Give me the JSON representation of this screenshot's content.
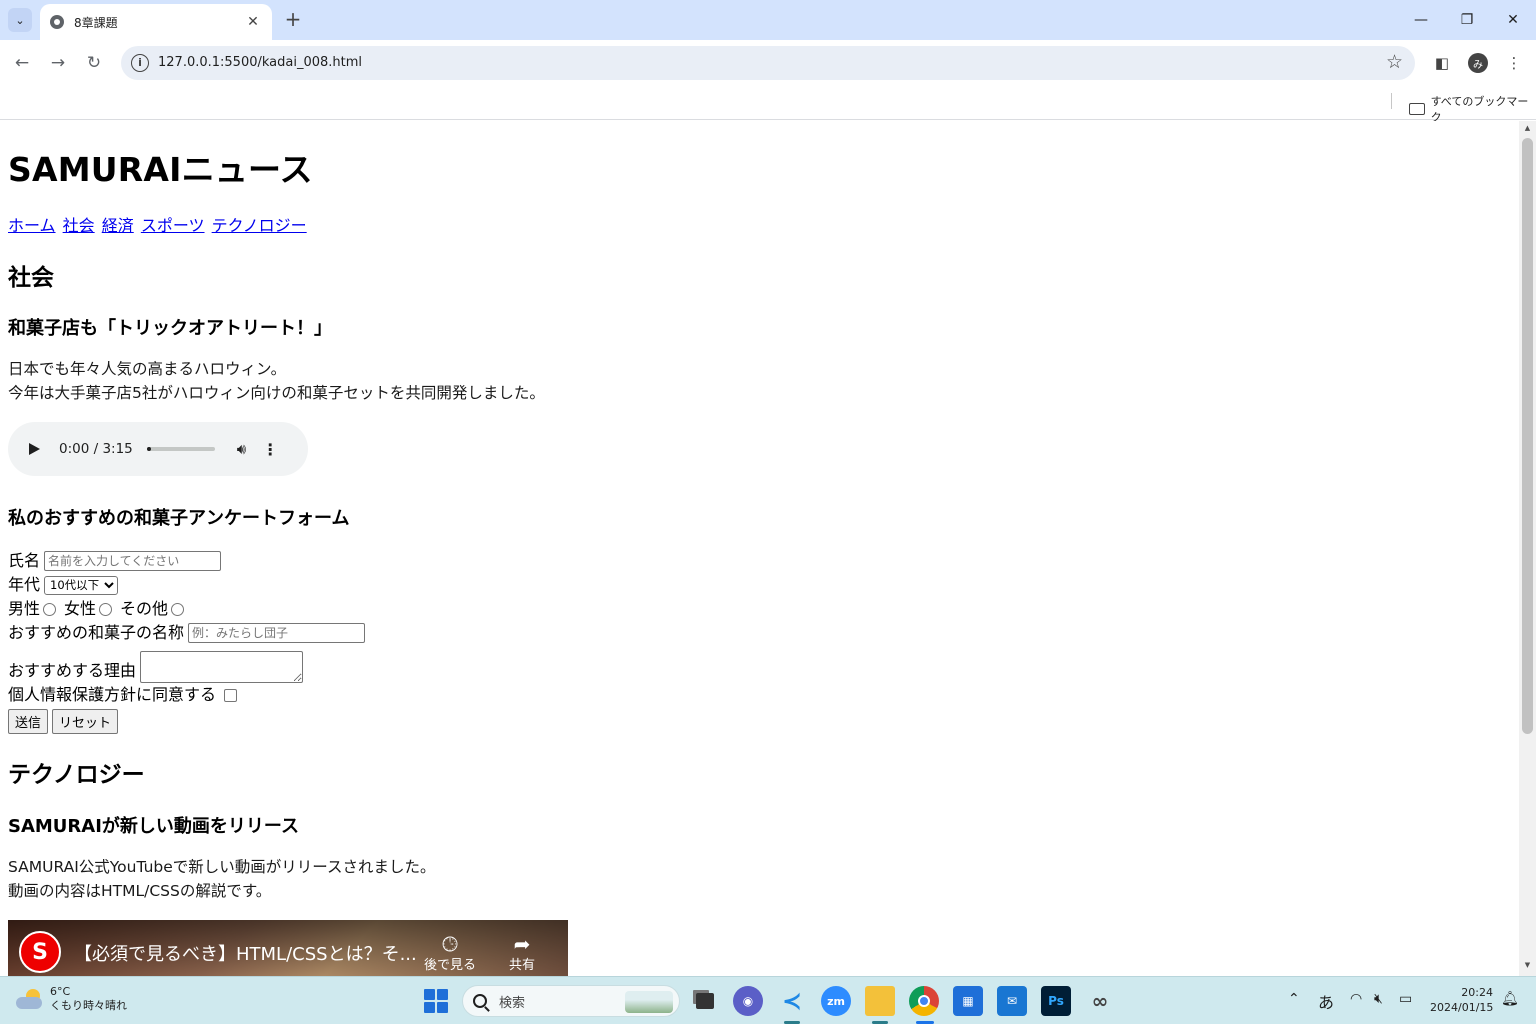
{
  "browser": {
    "tab_title": "8章課題",
    "url": "127.0.0.1:5500/kadai_008.html",
    "bookmarks_all": "すべてのブックマーク",
    "avatar_letter": "み"
  },
  "page": {
    "site_title": "SAMURAIニュース",
    "nav": [
      "ホーム",
      "社会",
      "経済",
      "スポーツ",
      "テクノロジー"
    ],
    "society": {
      "heading": "社会",
      "article_title": "和菓子店も「トリックオアトリート！」",
      "body_line1": "日本でも年々人気の高まるハロウィン。",
      "body_line2": "今年は大手菓子店5社がハロウィン向けの和菓子セットを共同開発しました。",
      "audio_time": "0:00 / 3:15",
      "audio_progress": 0.05
    },
    "form": {
      "title": "私のおすすめの和菓子アンケートフォーム",
      "name_label": "氏名",
      "name_placeholder": "名前を入力してください",
      "age_label": "年代",
      "age_selected": "10代以下",
      "gender_male": "男性",
      "gender_female": "女性",
      "gender_other": "その他",
      "wagashi_label": "おすすめの和菓子の名称",
      "wagashi_placeholder": "例：みたらし団子",
      "reason_label": "おすすめする理由",
      "privacy_label": "個人情報保護方針に同意する",
      "submit_label": "送信",
      "reset_label": "リセット"
    },
    "tech": {
      "heading": "テクノロジー",
      "article_title": "SAMURAIが新しい動画をリリース",
      "body_line1": "SAMURAI公式YouTubeで新しい動画がリリースされました。",
      "body_line2": "動画の内容はHTML/CSSの解説です。",
      "video_title": "【必須で見るべき】HTML/CSSとは？そ...",
      "watch_later": "後で見る",
      "share": "共有"
    }
  },
  "taskbar": {
    "temperature": "6°C",
    "weather": "くもり時々晴れ",
    "search_label": "検索",
    "ime": "あ",
    "time": "20:24",
    "date": "2024/01/15"
  },
  "colors": {
    "tabstrip": "#d3e3fd",
    "link": "#0000ee",
    "taskbar": "#cfe9ee"
  }
}
